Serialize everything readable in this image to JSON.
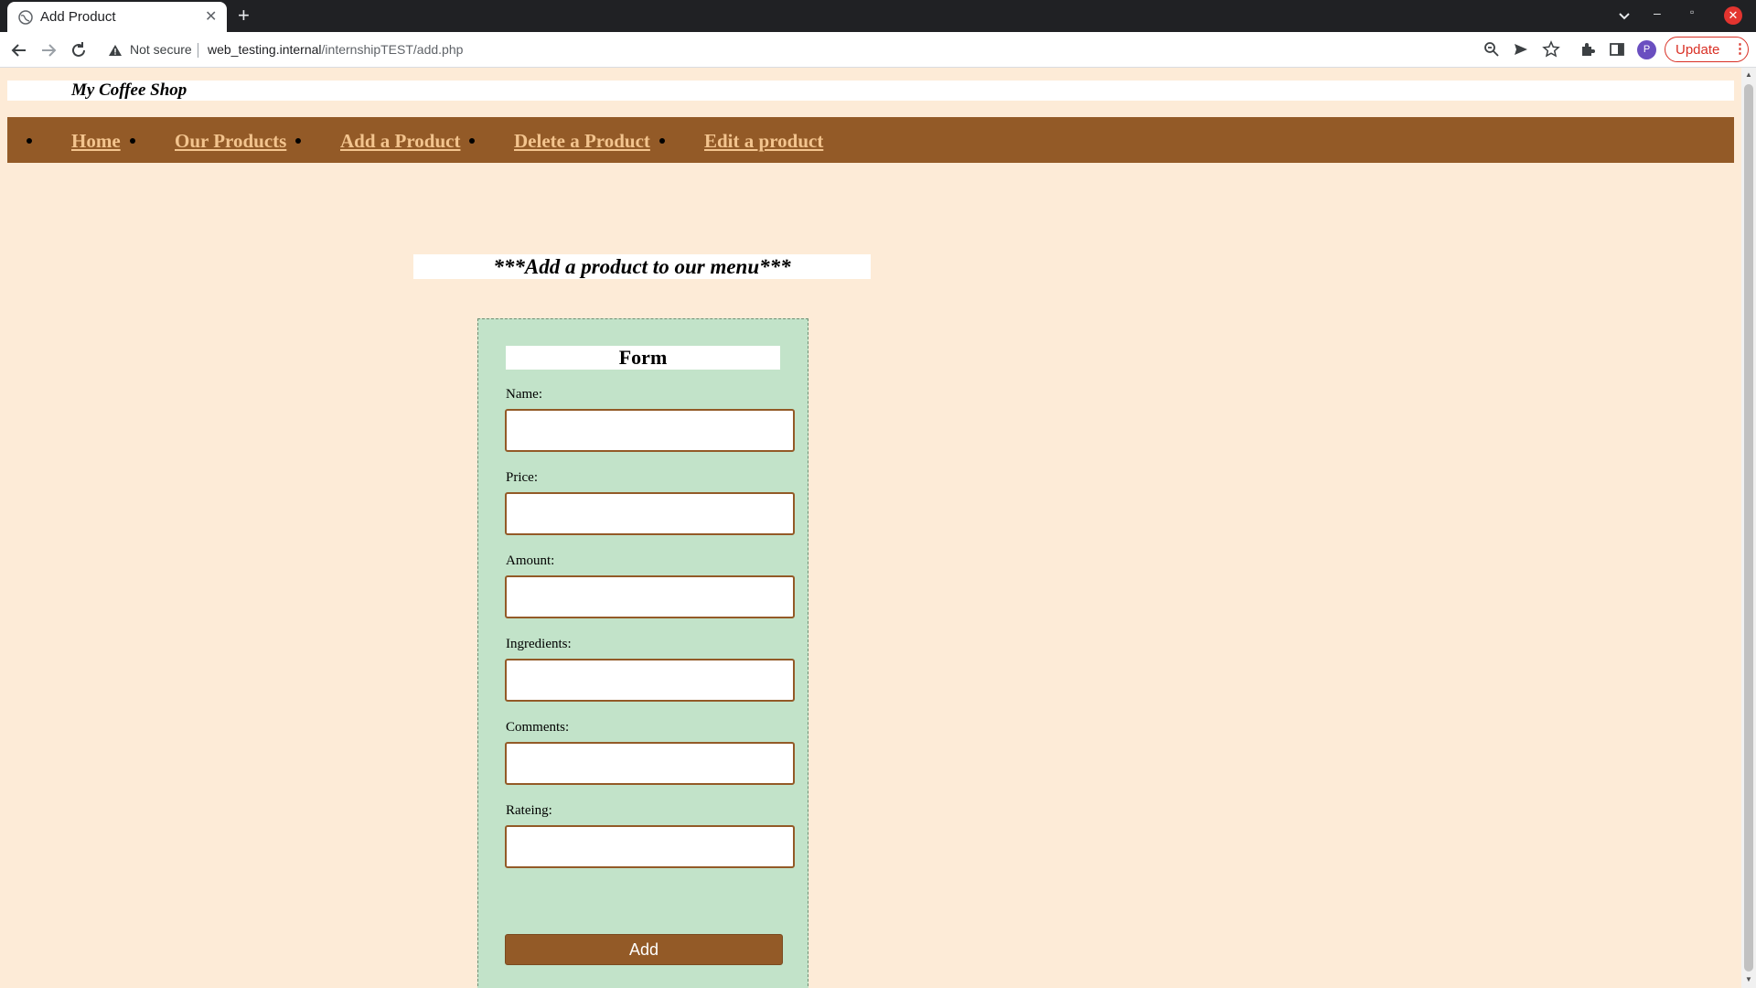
{
  "browser": {
    "tab_title": "Add Product",
    "security_label": "Not secure",
    "url_host": "web_testing.internal",
    "url_path": "/internshipTEST/add.php",
    "profile_initial": "P",
    "update_label": "Update"
  },
  "site": {
    "title": "My Coffee Shop",
    "nav": [
      "Home",
      "Our Products",
      "Add a Product",
      "Delete a Product",
      "Edit a product"
    ]
  },
  "page": {
    "heading": "***Add a product to our menu***"
  },
  "form": {
    "title": "Form",
    "fields": [
      {
        "label": "Name:",
        "value": ""
      },
      {
        "label": "Price:",
        "value": ""
      },
      {
        "label": "Amount:",
        "value": ""
      },
      {
        "label": "Ingredients:",
        "value": ""
      },
      {
        "label": "Comments:",
        "value": ""
      },
      {
        "label": "Rateing:",
        "value": ""
      }
    ],
    "submit_label": "Add"
  },
  "colors": {
    "page_bg": "#fdebd7",
    "nav_bg": "#935a27",
    "nav_link": "#f3c48e",
    "form_bg": "#c2e3c9",
    "button_bg": "#935a27"
  }
}
